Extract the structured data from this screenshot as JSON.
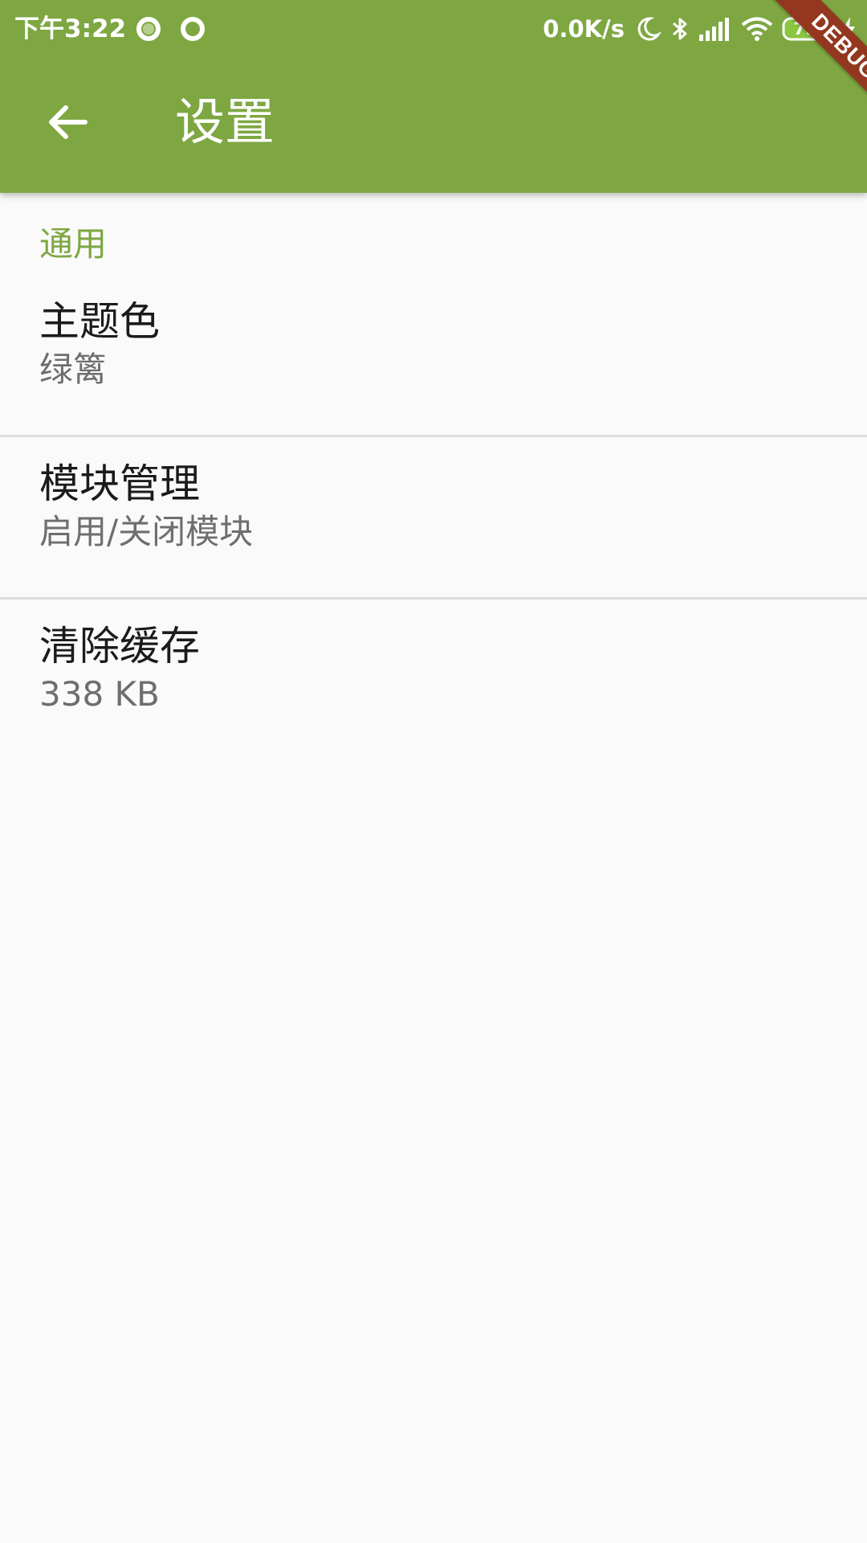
{
  "status_bar": {
    "time": "下午3:22",
    "network_speed": "0.0K/s",
    "battery_level": "79",
    "icons": [
      "notification-circle-icon",
      "notification-circle-icon",
      "moon-icon",
      "bluetooth-icon",
      "cellular-signal-icon",
      "wifi-icon",
      "battery-icon",
      "charging-bolt-icon"
    ]
  },
  "debug_banner": "DEBUG",
  "app_bar": {
    "back_icon": "arrow-back-icon",
    "title": "设置",
    "color": "#7ea742"
  },
  "settings": {
    "section_title": "通用",
    "items": [
      {
        "title": "主题色",
        "subtitle": "绿篱"
      },
      {
        "title": "模块管理",
        "subtitle": "启用/关闭模块"
      },
      {
        "title": "清除缓存",
        "subtitle": "338 KB"
      }
    ]
  },
  "colors": {
    "accent": "#7ea742",
    "background": "#fafafa",
    "debug_ribbon": "#93381f"
  }
}
